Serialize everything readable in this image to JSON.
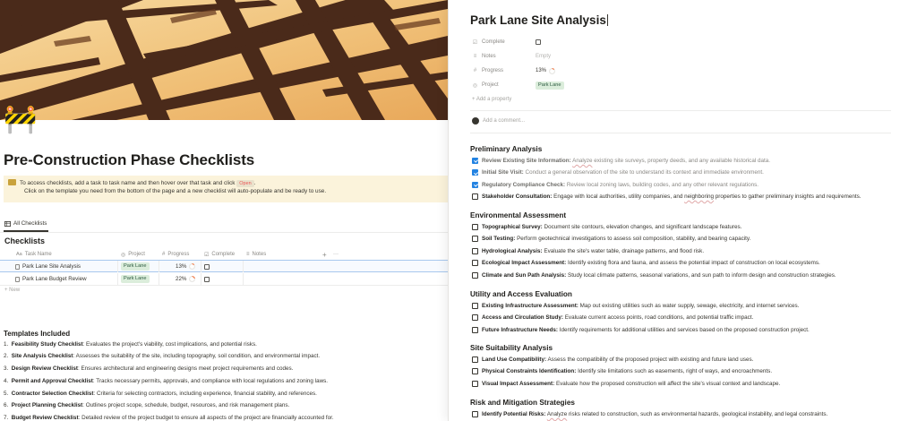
{
  "left_page": {
    "icon": "🚧",
    "title": "Pre-Construction Phase Checklists",
    "callout": {
      "line1": "To access checklists, add a task to task name and then hover over that task and click",
      "code": "Open",
      "line1_end": ".",
      "line2": "Click on the template you need from the bottom of the page and a new checklist will auto-populate and be ready to use."
    },
    "view_tab": "All Checklists",
    "database_title": "Checklists",
    "columns": [
      "Task Name",
      "Project",
      "Progress",
      "Complete",
      "Notes"
    ],
    "header_actions": [
      "+",
      "···"
    ],
    "rows": [
      {
        "name": "Park Lane Site Analysis",
        "project": "Park Lane",
        "progress": "13%",
        "progress_value": 0.13
      },
      {
        "name": "Park Lane Budget Review",
        "project": "Park Lane",
        "progress": "22%",
        "progress_value": 0.22
      }
    ],
    "new_label": "+ New",
    "templates_heading": "Templates Included",
    "templates": [
      {
        "num": "1.",
        "name": "Feasibility Study Checklist",
        "desc": ": Evaluates the project's viability, cost implications, and potential risks."
      },
      {
        "num": "2.",
        "name": "Site Analysis Checklist",
        "desc": ": Assesses the suitability of the site, including topography, soil condition, and environmental impact."
      },
      {
        "num": "3.",
        "name": "Design Review Checklist",
        "desc": ": Ensures architectural and engineering designs meet project requirements and codes."
      },
      {
        "num": "4.",
        "name": "Permit and Approval Checklist",
        "desc": ": Tracks necessary permits, approvals, and compliance with local regulations and zoning laws."
      },
      {
        "num": "5.",
        "name": "Contractor Selection Checklist",
        "desc": ": Criteria for selecting contractors, including experience, financial stability, and references."
      },
      {
        "num": "6.",
        "name": "Project Planning Checklist",
        "desc": ": Outlines project scope, schedule, budget, resources, and risk management plans."
      },
      {
        "num": "7.",
        "name": "Budget Review Checklist",
        "desc": ": Detailed review of the project budget to ensure all aspects of the project are financially accounted for."
      }
    ]
  },
  "panel": {
    "title": "Park Lane Site Analysis",
    "properties": [
      {
        "icon": "☑",
        "label": "Complete",
        "type": "checkbox",
        "value": ""
      },
      {
        "icon": "≡",
        "label": "Notes",
        "type": "empty",
        "value": "Empty"
      },
      {
        "icon": "#",
        "label": "Progress",
        "type": "progress",
        "value": "13%",
        "progress_value": 0.13
      },
      {
        "icon": "◎",
        "label": "Project",
        "type": "tag",
        "value": "Park Lane"
      }
    ],
    "add_property": "+ Add a property",
    "comment_placeholder": "Add a comment...",
    "sections": [
      {
        "heading": "Preliminary Analysis",
        "items": [
          {
            "checked": true,
            "bold": "Review Existing Site Information:",
            "parts": [
              {
                "t": " "
              },
              {
                "t": "Analyze",
                "sq": true
              },
              {
                "t": " existing site surveys, property deeds, and any available historical data."
              }
            ]
          },
          {
            "checked": true,
            "bold": "Initial Site Visit:",
            "parts": [
              {
                "t": " Conduct a general observation of the site to understand its context and immediate environment."
              }
            ]
          },
          {
            "checked": true,
            "bold": "Regulatory Compliance Check:",
            "parts": [
              {
                "t": " Review local zoning laws, building codes, and any other relevant regulations."
              }
            ]
          },
          {
            "checked": false,
            "bold": "Stakeholder Consultation:",
            "parts": [
              {
                "t": " Engage with local authorities, utility companies, and "
              },
              {
                "t": "neighboring",
                "sq": true
              },
              {
                "t": " properties to gather preliminary insights and requirements."
              }
            ]
          }
        ]
      },
      {
        "heading": "Environmental Assessment",
        "items": [
          {
            "checked": false,
            "bold": "Topographical Survey:",
            "parts": [
              {
                "t": " Document site contours, elevation changes, and significant landscape features."
              }
            ]
          },
          {
            "checked": false,
            "bold": "Soil Testing:",
            "parts": [
              {
                "t": " Perform geotechnical investigations to assess soil composition, stability, and bearing capacity."
              }
            ]
          },
          {
            "checked": false,
            "bold": "Hydrological Analysis:",
            "parts": [
              {
                "t": " Evaluate the site's water table, drainage patterns, and flood risk."
              }
            ]
          },
          {
            "checked": false,
            "bold": "Ecological Impact Assessment:",
            "parts": [
              {
                "t": " Identify existing flora and fauna, and assess the potential impact of construction on local ecosystems."
              }
            ]
          },
          {
            "checked": false,
            "bold": "Climate and Sun Path Analysis:",
            "parts": [
              {
                "t": " Study local climate patterns, seasonal variations, and sun path to inform design and construction strategies."
              }
            ]
          }
        ]
      },
      {
        "heading": "Utility and Access Evaluation",
        "items": [
          {
            "checked": false,
            "bold": "Existing Infrastructure Assessment:",
            "parts": [
              {
                "t": " Map out existing utilities such as water supply, sewage, electricity, and internet services."
              }
            ]
          },
          {
            "checked": false,
            "bold": "Access and Circulation Study:",
            "parts": [
              {
                "t": " Evaluate current access points, road conditions, and potential traffic impact."
              }
            ]
          },
          {
            "checked": false,
            "bold": "Future Infrastructure Needs:",
            "parts": [
              {
                "t": " Identify requirements for additional utilities and services based on the proposed construction project."
              }
            ]
          }
        ]
      },
      {
        "heading": "Site Suitability Analysis",
        "items": [
          {
            "checked": false,
            "bold": "Land Use Compatibility:",
            "parts": [
              {
                "t": " Assess the compatibility of the proposed project with existing and future land uses."
              }
            ]
          },
          {
            "checked": false,
            "bold": "Physical Constraints Identification:",
            "parts": [
              {
                "t": " Identify site limitations such as easements, right of ways, and encroachments."
              }
            ]
          },
          {
            "checked": false,
            "bold": "Visual Impact Assessment:",
            "parts": [
              {
                "t": " Evaluate how the proposed construction will affect the site's visual context and landscape."
              }
            ]
          }
        ]
      },
      {
        "heading": "Risk and Mitigation Strategies",
        "items": [
          {
            "checked": false,
            "bold": "Identify Potential Risks:",
            "parts": [
              {
                "t": " "
              },
              {
                "t": "Analyze",
                "sq": true
              },
              {
                "t": " risks related to construction, such as environmental hazards, geological instability, and legal constraints."
              }
            ]
          }
        ]
      }
    ]
  },
  "colors": {
    "accent": "#2383e2",
    "tag_bg": "#dbeddb",
    "tag_text": "#2b593f",
    "callout_bg": "#fbf3db",
    "progress_ring": "#f07c4a"
  }
}
